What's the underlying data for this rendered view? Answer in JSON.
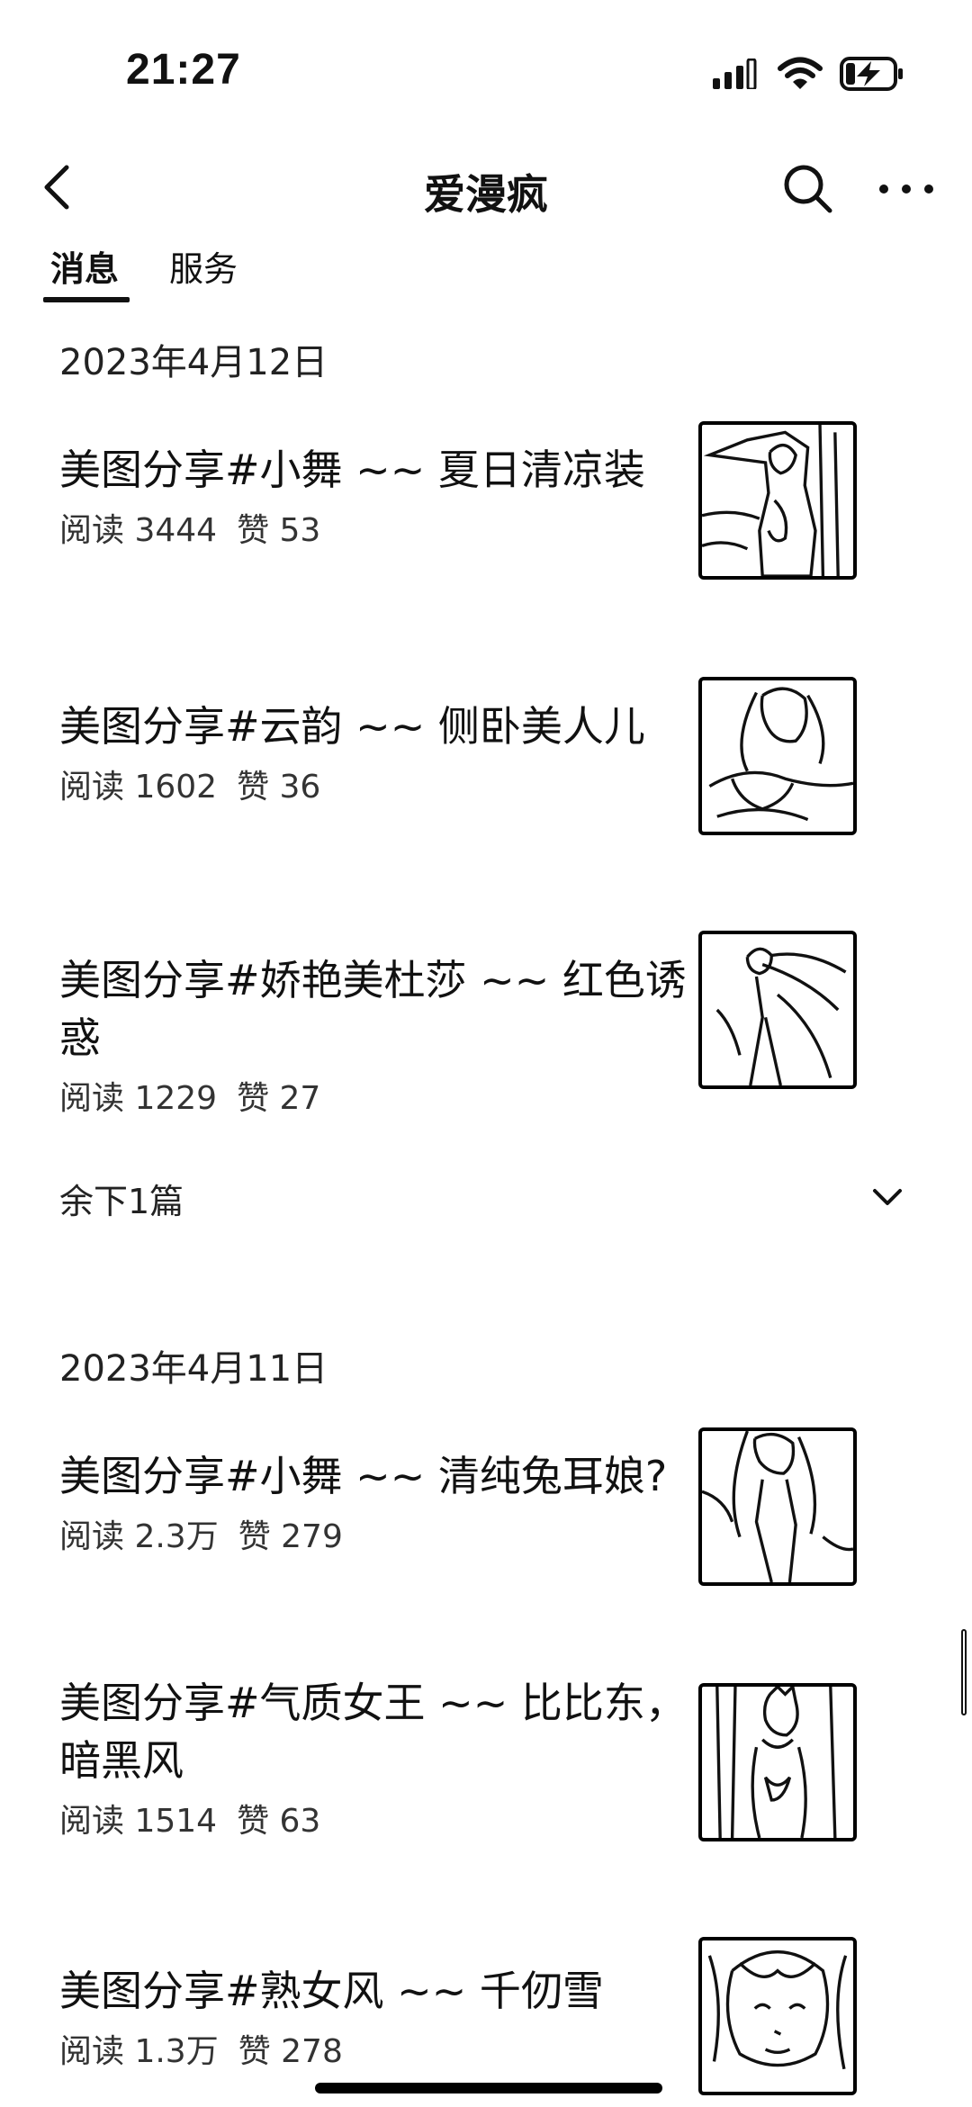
{
  "status_bar": {
    "time": "21:27",
    "icons": [
      "cellular-signal-icon",
      "wifi-icon",
      "battery-charging-icon"
    ]
  },
  "nav": {
    "title": "爱漫疯",
    "icons": [
      "back-icon",
      "search-icon",
      "more-icon"
    ]
  },
  "tabs": [
    {
      "label": "消息",
      "active": true
    },
    {
      "label": "服务",
      "active": false
    }
  ],
  "groups": [
    {
      "date": "2023年4月12日",
      "articles": [
        {
          "title": "美图分享#小舞 ~~ 夏日清凉装",
          "reads": "阅读 3444",
          "likes": "赞 53"
        },
        {
          "title": "美图分享#云韵 ~~ 侧卧美人儿",
          "reads": "阅读 1602",
          "likes": "赞 36"
        },
        {
          "title": "美图分享#娇艳美杜莎 ~~ 红色诱惑",
          "reads": "阅读 1229",
          "likes": "赞 27"
        }
      ],
      "more": "余下1篇"
    },
    {
      "date": "2023年4月11日",
      "articles": [
        {
          "title": "美图分享#小舞 ~~ 清纯兔耳娘?",
          "reads": "阅读 2.3万",
          "likes": "赞 279"
        },
        {
          "title": "美图分享#气质女王 ~~ 比比东，暗黑风",
          "reads": "阅读 1514",
          "likes": "赞 63"
        },
        {
          "title": "美图分享#熟女风 ~~ 千仞雪",
          "reads": "阅读 1.3万",
          "likes": "赞 278"
        }
      ]
    }
  ]
}
